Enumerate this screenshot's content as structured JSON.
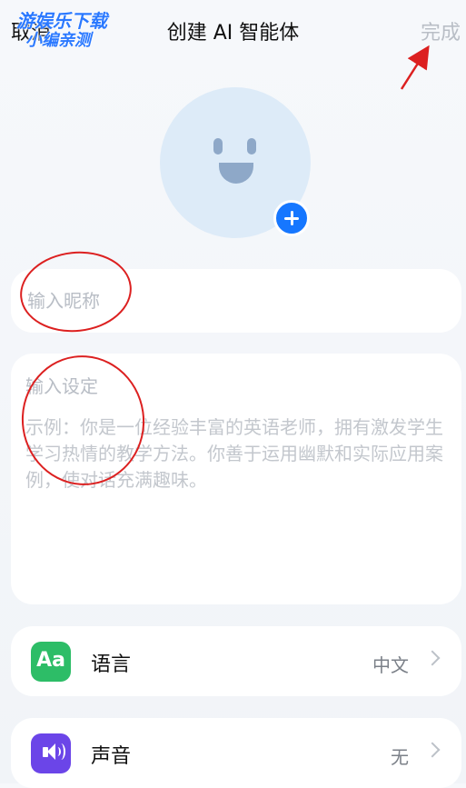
{
  "header": {
    "cancel_label": "取消",
    "title": "创建 AI 智能体",
    "done_label": "完成"
  },
  "watermark": {
    "line1": "游娱乐下载",
    "line2": "小编亲测"
  },
  "avatar": {
    "icon": "smiley-face-icon",
    "add_icon": "plus-icon"
  },
  "form": {
    "nickname_placeholder": "输入昵称",
    "setting_label": "输入设定",
    "setting_example": "示例：你是一位经验丰富的英语老师，拥有激发学生学习热情的教学方法。你善于运用幽默和实际应用案例，使对话充满趣味。"
  },
  "settings": {
    "language": {
      "label": "语言",
      "value": "中文",
      "icon": "language-icon"
    },
    "voice": {
      "label": "声音",
      "value": "无",
      "icon": "speaker-icon"
    }
  },
  "colors": {
    "accent": "#1677ff",
    "language_icon_bg": "#2dbd67",
    "voice_icon_bg": "#6b45e8",
    "annotation": "#dc2020"
  }
}
